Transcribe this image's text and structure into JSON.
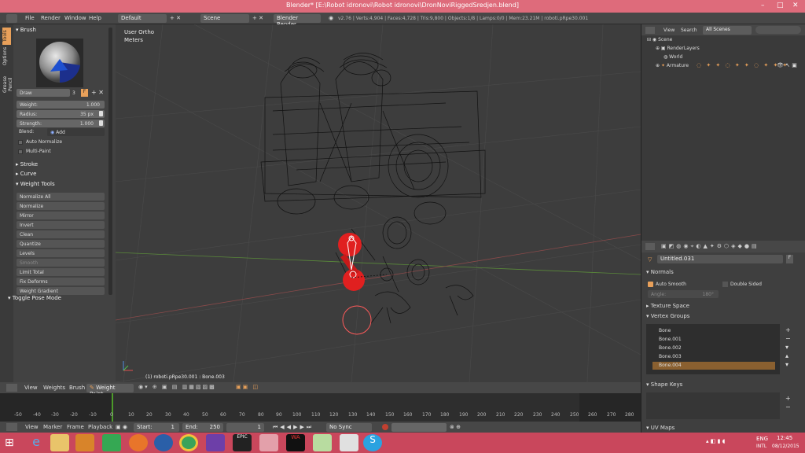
{
  "window": {
    "title": "Blender* [E:\\Robot idronovi\\Robot idronovi\\DronNoviRiggedSredjen.blend]",
    "controls": [
      "–",
      "□",
      "✕"
    ]
  },
  "menubar": {
    "items": [
      "File",
      "Render",
      "Window",
      "Help"
    ],
    "layout": "Default",
    "scene": "Scene",
    "engine": "Blender Render",
    "stats": "v2.76 | Verts:4,904 | Faces:4,728 | Tris:9,800 | Objects:1/8 | Lamps:0/0 | Mem:23.21M | roboti.pRpe30.001"
  },
  "toolshelf": {
    "tabs": [
      "Tools",
      "Options",
      "Grease Pencil"
    ],
    "brush_header": "Brush",
    "brush_name": "Draw",
    "brush_users": "3",
    "weight_label": "Weight:",
    "weight_value": "1.000",
    "radius_label": "Radius:",
    "radius_value": "35 px",
    "strength_label": "Strength:",
    "strength_value": "1.000",
    "blend_label": "Blend:",
    "blend_value": "Add",
    "auto_normalize": "Auto Normalize",
    "multi_paint": "Multi-Paint",
    "stroke": "Stroke",
    "curve": "Curve",
    "weight_tools": "Weight Tools",
    "tools": [
      "Normalize All",
      "Normalize",
      "Mirror",
      "Invert",
      "Clean",
      "Quantize",
      "Levels",
      "Smooth",
      "Limit Total",
      "Fix Deforms",
      "Weight Gradient"
    ],
    "toggle_pose": "Toggle Pose Mode"
  },
  "viewport": {
    "view_name": "User Ortho",
    "units": "Meters",
    "object_info": "(1) roboti.pRpe30.001 : Bone.003"
  },
  "outliner": {
    "tabs": [
      "View",
      "Search"
    ],
    "scenes_filter": "All Scenes",
    "items": [
      "Scene",
      "RenderLayers",
      "World",
      "Armature"
    ]
  },
  "properties": {
    "datablock": "Untitled.031",
    "normals": "Normals",
    "auto_smooth": "Auto Smooth",
    "double_sided": "Double Sided",
    "angle_label": "Angle:",
    "angle_value": "180°",
    "texture_space": "Texture Space",
    "vertex_groups": "Vertex Groups",
    "groups": [
      "Bone",
      "Bone.001",
      "Bone.002",
      "Bone.003",
      "Bone.004"
    ],
    "shape_keys": "Shape Keys",
    "uv_maps": "UV Maps"
  },
  "viewport_header": {
    "items": [
      "View",
      "Weights",
      "Brush"
    ],
    "mode": "Weight Paint"
  },
  "timeline": {
    "ticks": [
      "-50",
      "-40",
      "-30",
      "-20",
      "-10",
      "0",
      "10",
      "20",
      "30",
      "40",
      "50",
      "60",
      "70",
      "80",
      "90",
      "100",
      "110",
      "120",
      "130",
      "140",
      "150",
      "160",
      "170",
      "180",
      "190",
      "200",
      "210",
      "220",
      "230",
      "240",
      "250",
      "260",
      "270",
      "280"
    ],
    "menu": [
      "View",
      "Marker",
      "Frame",
      "Playback"
    ],
    "start_label": "Start:",
    "start_value": "1",
    "end_label": "End:",
    "end_value": "250",
    "current": "1",
    "sync": "No Sync"
  },
  "taskbar": {
    "lang": "ENG",
    "layout": "INTL",
    "time": "12:45",
    "date": "08/12/2015"
  },
  "colors": {
    "accent": "#e8a05a",
    "paint_red": "#e02020",
    "selected_group": "#8a6030"
  }
}
